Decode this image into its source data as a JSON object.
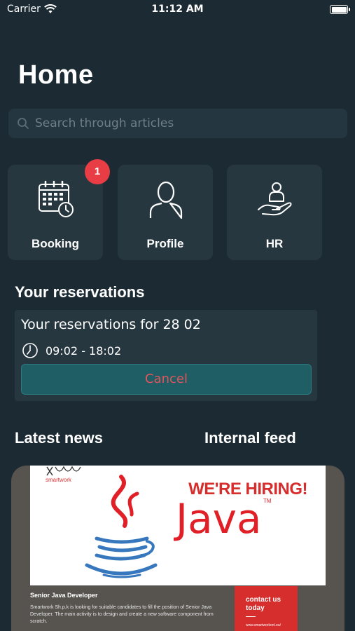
{
  "status_bar": {
    "carrier": "Carrier",
    "time": "11:12 AM"
  },
  "page": {
    "title": "Home"
  },
  "search": {
    "placeholder": "Search through articles"
  },
  "tiles": [
    {
      "label": "Booking",
      "icon": "calendar-clock-icon",
      "badge": "1"
    },
    {
      "label": "Profile",
      "icon": "person-icon"
    },
    {
      "label": "HR",
      "icon": "hand-person-icon"
    }
  ],
  "reservations": {
    "title": "Your reservations",
    "card_text": "Your reservations for 28 02",
    "time_range": "09:02 - 18:02",
    "cancel_label": "Cancel"
  },
  "feed_tabs": {
    "latest_news": "Latest news",
    "internal_feed": "Internal feed"
  },
  "news_card": {
    "logo_text": "smartwork",
    "hiring": "WE'RE HIRING!",
    "java": "Java",
    "tm": "TM",
    "job_title": "Senior Java Developer",
    "job_desc": "Smartwork Sh.p.k is looking for suitable candidates to fill the position of Senior Java Developer. The main activity is to design and create a new software component from scratch.",
    "contact": "contact us today",
    "site": "www.smartworkonl.eu/"
  },
  "colors": {
    "background": "#1b2a33",
    "card": "#263740",
    "badge": "#e83d44",
    "cancel_bg": "#1e5e64",
    "cancel_text": "#e0555b",
    "java_red": "#e11f26",
    "java_blue": "#3677bd"
  }
}
